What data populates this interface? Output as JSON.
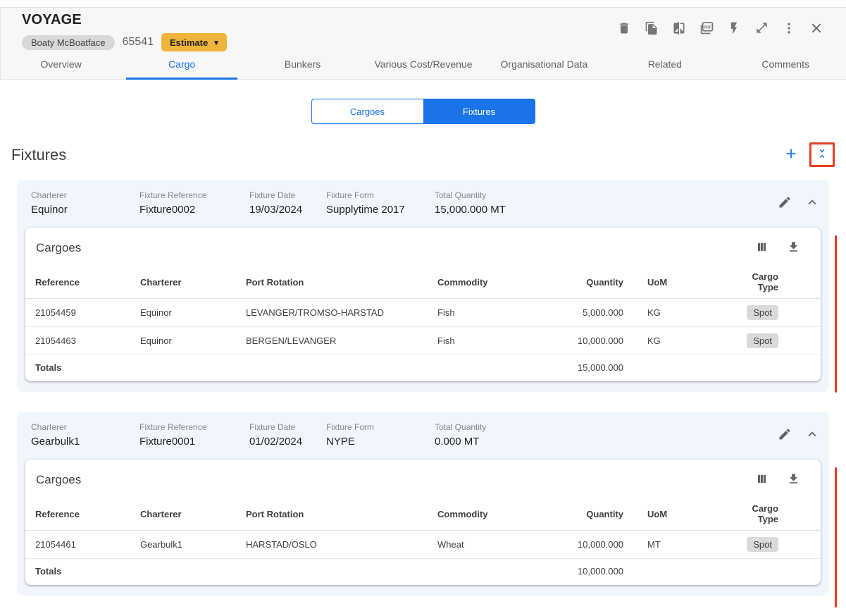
{
  "colors": {
    "accent_blue": "#1a73e8",
    "estimate_amber": "#f0b43c",
    "fixture_card_bg": "#f1f5fc",
    "highlight_red": "#e23e26",
    "chip_gray": "#d8d8d8"
  },
  "header": {
    "title": "VOYAGE",
    "vessel_name": "Boaty McBoatface",
    "voyage_number": "65541",
    "estimate_label": "Estimate",
    "toolbar_icons": [
      "delete",
      "copy",
      "compare",
      "pdf-export",
      "quick-actions",
      "open-in-full",
      "more-vertical",
      "close"
    ]
  },
  "tabs": [
    {
      "label": "Overview",
      "active": false
    },
    {
      "label": "Cargo",
      "active": true
    },
    {
      "label": "Bunkers",
      "active": false
    },
    {
      "label": "Various Cost/Revenue",
      "active": false
    },
    {
      "label": "Organisational Data",
      "active": false
    },
    {
      "label": "Related",
      "active": false
    },
    {
      "label": "Comments",
      "active": false
    }
  ],
  "view_toggle": {
    "cargoes_label": "Cargoes",
    "fixtures_label": "Fixtures",
    "selected": "Fixtures"
  },
  "section": {
    "title": "Fixtures"
  },
  "fixtures": [
    {
      "fields": [
        {
          "label": "Charterer",
          "value": "Equinor"
        },
        {
          "label": "Fixture Reference",
          "value": "Fixture0002"
        },
        {
          "label": "Fixture Date",
          "value": "19/03/2024"
        },
        {
          "label": "Fixture Form",
          "value": "Supplytime 2017"
        },
        {
          "label": "Total Quantity",
          "value": "15,000.000 MT"
        }
      ],
      "cargoes": {
        "title": "Cargoes",
        "columns": [
          "Reference",
          "Charterer",
          "Port Rotation",
          "Commodity",
          "Quantity",
          "UoM",
          "Cargo Type"
        ],
        "rows": [
          {
            "reference": "21054459",
            "charterer": "Equinor",
            "port_rotation": "LEVANGER/TROMSO-HARSTAD",
            "commodity": "Fish",
            "quantity": "5,000.000",
            "uom": "KG",
            "cargo_type": "Spot"
          },
          {
            "reference": "21054463",
            "charterer": "Equinor",
            "port_rotation": "BERGEN/LEVANGER",
            "commodity": "Fish",
            "quantity": "10,000.000",
            "uom": "KG",
            "cargo_type": "Spot"
          }
        ],
        "totals_label": "Totals",
        "totals_quantity": "15,000.000"
      }
    },
    {
      "fields": [
        {
          "label": "Charterer",
          "value": "Gearbulk1"
        },
        {
          "label": "Fixture Reference",
          "value": "Fixture0001"
        },
        {
          "label": "Fixture Date",
          "value": "01/02/2024"
        },
        {
          "label": "Fixture Form",
          "value": "NYPE"
        },
        {
          "label": "Total Quantity",
          "value": "0.000 MT"
        }
      ],
      "cargoes": {
        "title": "Cargoes",
        "columns": [
          "Reference",
          "Charterer",
          "Port Rotation",
          "Commodity",
          "Quantity",
          "UoM",
          "Cargo Type"
        ],
        "rows": [
          {
            "reference": "21054461",
            "charterer": "Gearbulk1",
            "port_rotation": "HARSTAD/OSLO",
            "commodity": "Wheat",
            "quantity": "10,000.000",
            "uom": "MT",
            "cargo_type": "Spot"
          }
        ],
        "totals_label": "Totals",
        "totals_quantity": "10,000.000"
      }
    }
  ]
}
